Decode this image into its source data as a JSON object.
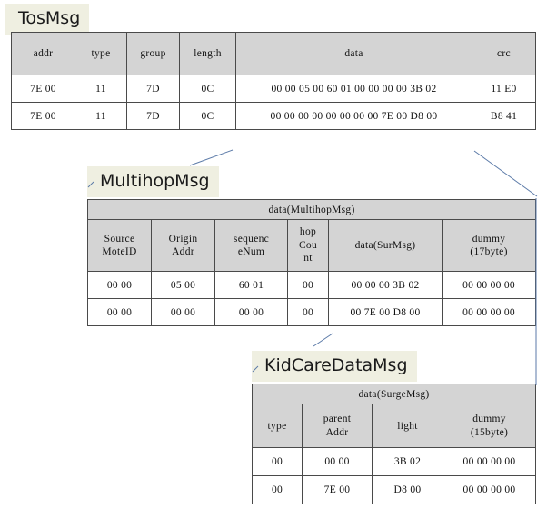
{
  "page": {
    "background": "#ffffff",
    "header_fill": "#D4D4D4",
    "chip_fill": "#EFEFE1",
    "border_color": "#4a4a4a",
    "connector_color": "#5b7aa8"
  },
  "diagram": {
    "title_tosmsg": "TosMsg",
    "title_multihop": "MultihopMsg",
    "title_kidcare": "KidCareDataMsg"
  },
  "tosmsg": {
    "columns": [
      "addr",
      "type",
      "group",
      "length",
      "data",
      "crc"
    ],
    "rows": [
      [
        "7E 00",
        "11",
        "7D",
        "0C",
        "00 00  05 00  60 01  00 00  00 00  3B 02",
        "11 E0"
      ],
      [
        "7E 00",
        "11",
        "7D",
        "0C",
        "00 00  00 00  00 00  00 00  7E 00  D8 00",
        "B8 41"
      ]
    ]
  },
  "multihopmsg": {
    "group_header": "data(MultihopMsg)",
    "columns": [
      "Source\nMoteID",
      "Origin\nAddr",
      "sequenc\neNum",
      "hop\nCou\nnt",
      "data(SurMsg)",
      "dummy\n(17byte)"
    ],
    "columns_flat": [
      "Source MoteID",
      "Origin Addr",
      "sequenc eNum",
      "hop Cou nt",
      "data(SurMsg)",
      "dummy (17byte)"
    ],
    "col0_l1": "Source",
    "col0_l2": "MoteID",
    "col1_l1": "Origin",
    "col1_l2": "Addr",
    "col2_l1": "sequenc",
    "col2_l2": "eNum",
    "col3_l1": "hop",
    "col3_l2": "Cou",
    "col3_l3": "nt",
    "col4_l1": "data(SurMsg)",
    "col5_l1": "dummy",
    "col5_l2": "(17byte)",
    "rows": [
      [
        "00 00",
        "05 00",
        "60 01",
        "00",
        "00 00  00 3B  02",
        "00 00  00 00"
      ],
      [
        "00 00",
        "00 00",
        "00 00",
        "00",
        "00 7E  00 D8  00",
        "00 00  00 00"
      ]
    ]
  },
  "kidcaredatamsg": {
    "group_header": "data(SurgeMsg)",
    "columns_flat": [
      "type",
      "parent Addr",
      "light",
      "dummy (15byte)"
    ],
    "col0_l1": "type",
    "col1_l1": "parent",
    "col1_l2": "Addr",
    "col2_l1": "light",
    "col3_l1": "dummy",
    "col3_l2": "(15byte)",
    "rows": [
      [
        "00",
        "00 00",
        "3B 02",
        "00 00  00 00"
      ],
      [
        "00",
        "7E 00",
        "D8 00",
        "00 00  00 00"
      ]
    ]
  }
}
